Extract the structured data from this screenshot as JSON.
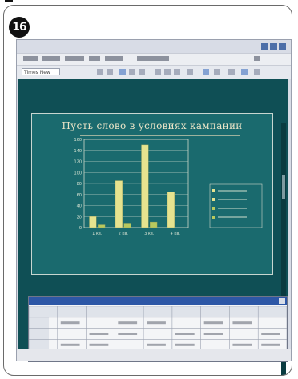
{
  "step": {
    "number": "16"
  },
  "slide": {
    "title": "Пусть слово в условиях кампании"
  },
  "toolbar": {
    "font": "Times New"
  },
  "chart_data": {
    "type": "bar",
    "categories": [
      "1 кв.",
      "2 кв.",
      "3 кв.",
      "4 кв."
    ],
    "series": [
      {
        "values": [
          20,
          85,
          150,
          65
        ],
        "color": "#e6e38f"
      },
      {
        "values": [
          5,
          8,
          10,
          0
        ],
        "color": "#b8c95e"
      }
    ],
    "ylim": [
      0,
      160
    ],
    "yticks": [
      "0",
      "20",
      "40",
      "60",
      "80",
      "100",
      "120",
      "140",
      "160"
    ],
    "legend_placement": "right",
    "grid": true
  },
  "colors": {
    "slide_bg": "#1a6a6e",
    "bar": "#e6e38f",
    "titlebar": "#2d57a6"
  }
}
